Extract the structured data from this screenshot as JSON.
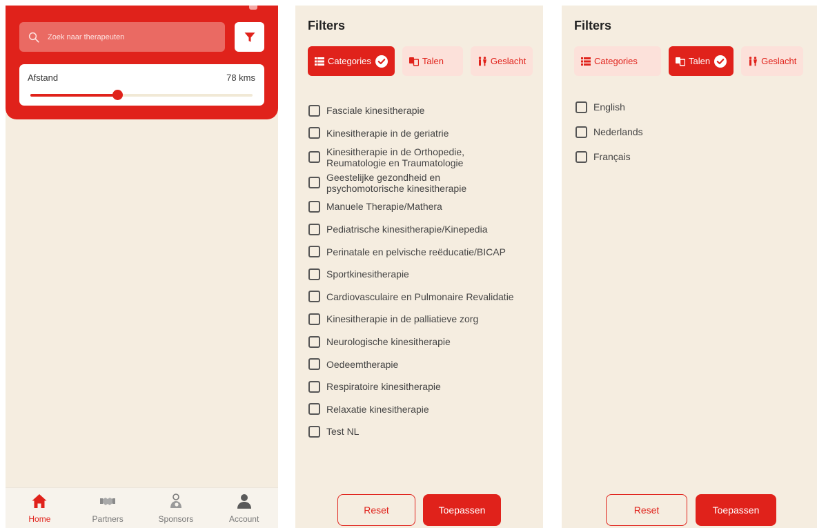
{
  "colors": {
    "brand_red": "#e0221b",
    "background": "#f5ede0",
    "chip_inactive": "#fce1da"
  },
  "screen1": {
    "search": {
      "placeholder": "Zoek naar therapeuten",
      "icon": "search-icon"
    },
    "filter_button_icon": "filter-funnel-icon",
    "distance": {
      "label": "Afstand",
      "value": "78 kms",
      "slider_fraction": 0.39
    },
    "nav": [
      {
        "label": "Home",
        "icon": "home-icon",
        "active": true
      },
      {
        "label": "Partners",
        "icon": "handshake-icon",
        "active": false
      },
      {
        "label": "Sponsors",
        "icon": "sponsor-icon",
        "active": false
      },
      {
        "label": "Account",
        "icon": "user-icon",
        "active": false
      }
    ]
  },
  "screen2": {
    "title": "Filters",
    "chips": [
      {
        "label": "Categories",
        "icon": "list-icon",
        "active": true
      },
      {
        "label": "Talen",
        "icon": "translate-icon",
        "active": false
      },
      {
        "label": "Geslacht",
        "icon": "gender-icon",
        "active": false
      }
    ],
    "categories": [
      "Fasciale kinesitherapie",
      "Kinesitherapie in de geriatrie",
      "Kinesitherapie in de Orthopedie, Reumatologie en Traumatologie",
      "Geestelijke gezondheid en psychomotorische kinesitherapie",
      "Manuele Therapie/Mathera",
      "Pediatrische kinesitherapie/Kinepedia",
      "Perinatale en pelvische reëducatie/BICAP",
      "Sportkinesitherapie",
      "Cardiovasculaire en Pulmonaire Revalidatie",
      "Kinesitherapie in de palliatieve zorg",
      "Neurologische kinesitherapie",
      "Oedeemtherapie",
      "Respiratoire kinesitherapie",
      "Relaxatie kinesitherapie",
      "Test NL"
    ],
    "reset_label": "Reset",
    "apply_label": "Toepassen"
  },
  "screen3": {
    "title": "Filters",
    "chips": [
      {
        "label": "Categories",
        "icon": "list-icon",
        "active": false
      },
      {
        "label": "Talen",
        "icon": "translate-icon",
        "active": true
      },
      {
        "label": "Geslacht",
        "icon": "gender-icon",
        "active": false
      }
    ],
    "languages": [
      "English",
      "Nederlands",
      "Français"
    ],
    "reset_label": "Reset",
    "apply_label": "Toepassen"
  }
}
